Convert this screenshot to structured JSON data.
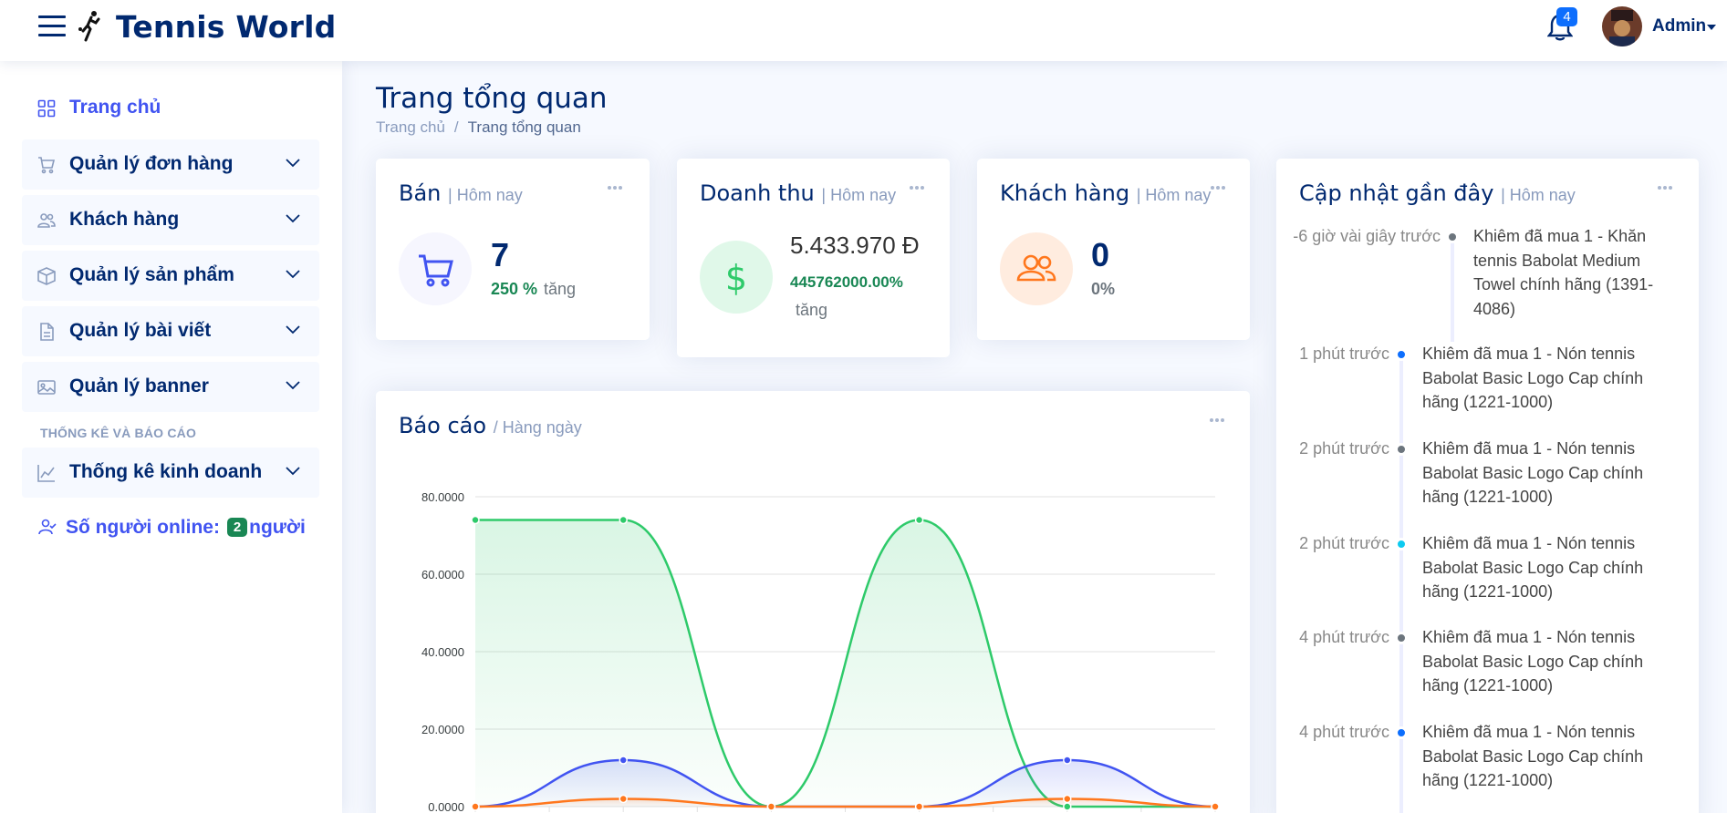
{
  "header": {
    "brand": "Tennis World",
    "notification_count": "4",
    "user_name": "Admin"
  },
  "sidebar": {
    "items": [
      {
        "label": "Trang chủ",
        "icon": "grid-icon"
      },
      {
        "label": "Quản lý đơn hàng",
        "icon": "cart-icon"
      },
      {
        "label": "Khách hàng",
        "icon": "people-icon"
      },
      {
        "label": "Quản lý sản phẩm",
        "icon": "box-icon"
      },
      {
        "label": "Quản lý bài viết",
        "icon": "document-icon"
      },
      {
        "label": "Quản lý banner",
        "icon": "image-icon"
      }
    ],
    "heading": "THỐNG KÊ VÀ BÁO CÁO",
    "stats_item": {
      "label": "Thống kê kinh doanh",
      "icon": "graph-icon"
    },
    "online": {
      "prefix": "Số người online:",
      "count": "2",
      "suffix": "người"
    }
  },
  "page": {
    "title": "Trang tổng quan",
    "breadcrumb": [
      "Trang chủ",
      "Trang tổng quan"
    ]
  },
  "cards": {
    "sales": {
      "title": "Bán",
      "sub": "| Hôm nay",
      "value": "7",
      "pct": "250 %",
      "trend": "tăng"
    },
    "revenue": {
      "title": "Doanh thu",
      "sub": "| Hôm nay",
      "value": "5.433.970 Đ",
      "pct": "445762000.00%",
      "trend": "tăng"
    },
    "customers": {
      "title": "Khách hàng",
      "sub": "| Hôm nay",
      "value": "0",
      "pct": "0%"
    }
  },
  "report": {
    "title": "Báo cáo",
    "sub": "/ Hàng ngày"
  },
  "chart_data": {
    "type": "area",
    "y_ticks": [
      "80.0000",
      "60.0000",
      "40.0000",
      "20.0000",
      "0.0000"
    ],
    "ylim": [
      0,
      80
    ],
    "x": [
      0,
      1,
      2,
      3,
      4,
      5
    ],
    "series": [
      {
        "values": [
          74,
          74,
          0,
          74,
          0,
          0
        ],
        "color": "#2eca6a"
      },
      {
        "values": [
          0,
          12,
          0,
          0,
          12,
          0
        ],
        "color": "#4154f1"
      },
      {
        "values": [
          0,
          2,
          0,
          0,
          2,
          0
        ],
        "color": "#ff771d"
      }
    ]
  },
  "updates": {
    "title": "Cập nhật gần đây",
    "sub": "| Hôm nay",
    "items": [
      {
        "time": "-6 giờ vài giây trước",
        "text": "Khiêm đã mua 1 - Khăn tennis Babolat Medium Towel chính hãng (1391-4086)",
        "color": "#6c757d"
      },
      {
        "time": "1 phút trước",
        "text": "Khiêm đã mua 1 - Nón tennis Babolat Basic Logo Cap chính hãng (1221-1000)",
        "color": "#0d6efd"
      },
      {
        "time": "2 phút trước",
        "text": "Khiêm đã mua 1 - Nón tennis Babolat Basic Logo Cap chính hãng (1221-1000)",
        "color": "#6c757d"
      },
      {
        "time": "2 phút trước",
        "text": "Khiêm đã mua 1 - Nón tennis Babolat Basic Logo Cap chính hãng (1221-1000)",
        "color": "#0dcaf0"
      },
      {
        "time": "4 phút trước",
        "text": "Khiêm đã mua 1 - Nón tennis Babolat Basic Logo Cap chính hãng (1221-1000)",
        "color": "#6c757d"
      },
      {
        "time": "4 phút trước",
        "text": "Khiêm đã mua 1 - Nón tennis Babolat Basic Logo Cap chính hãng (1221-1000)",
        "color": "#0d6efd"
      }
    ]
  }
}
